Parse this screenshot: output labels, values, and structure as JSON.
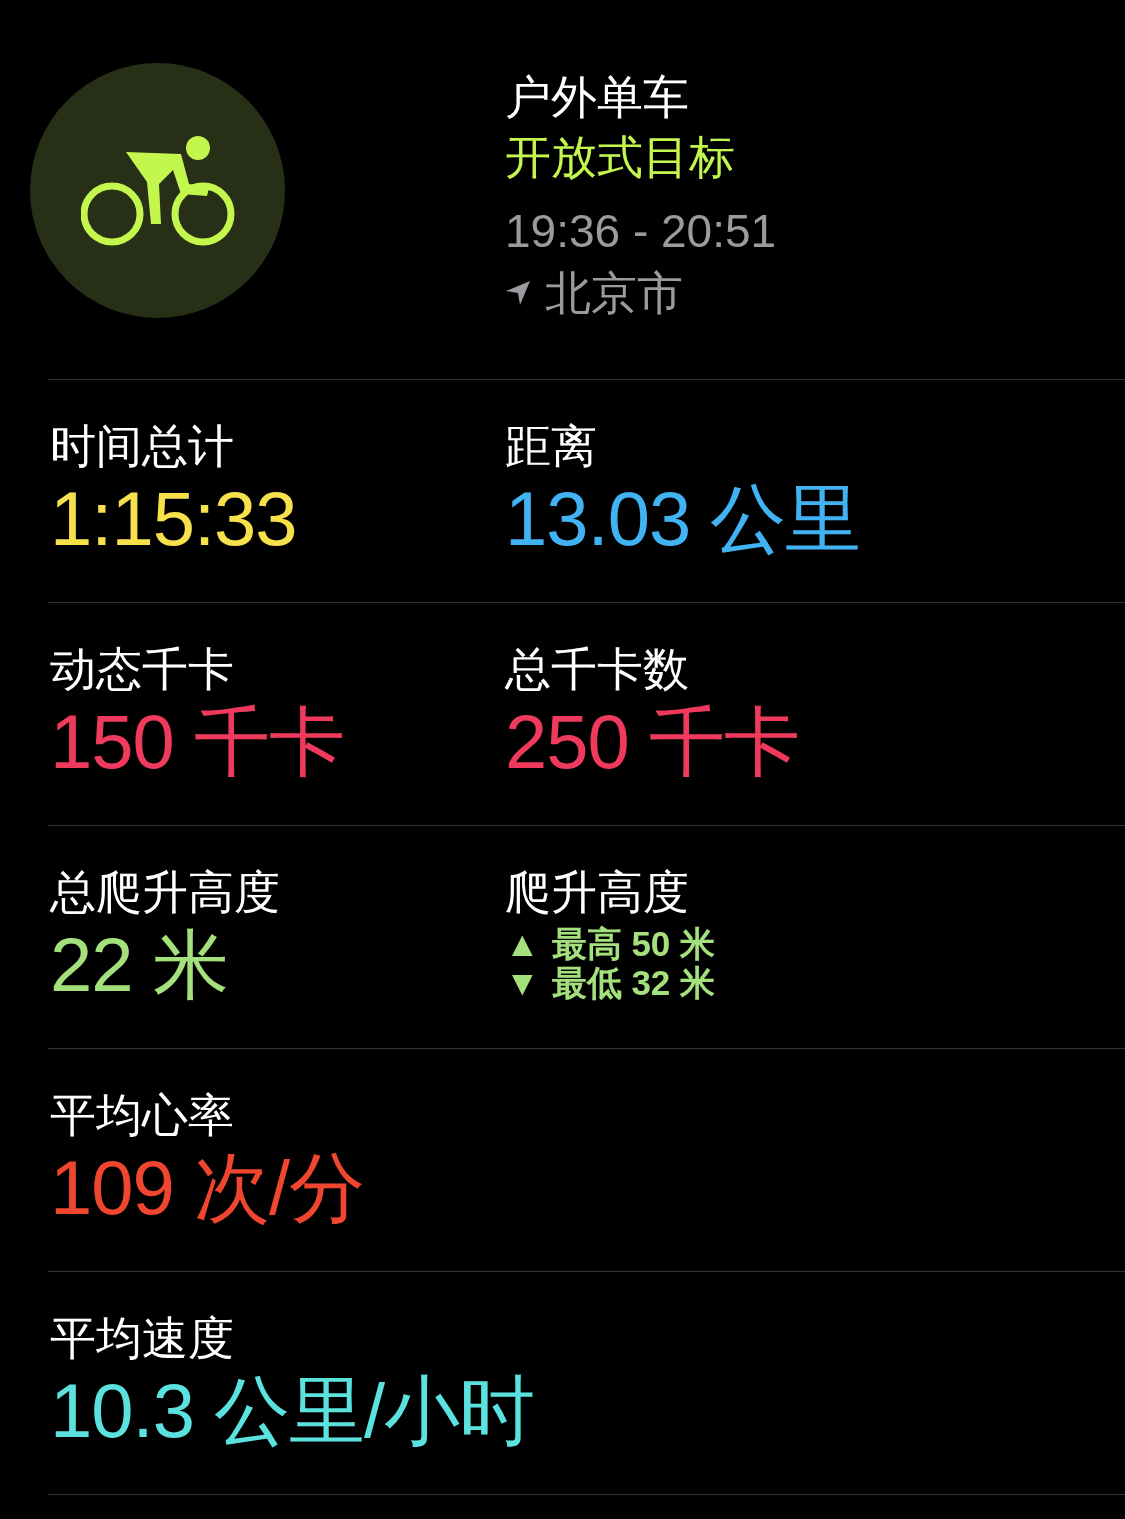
{
  "workout": {
    "title": "户外单车",
    "goal": "开放式目标",
    "time_range": "19:36 - 20:51",
    "location": "北京市"
  },
  "rows": [
    [
      {
        "kind": "value",
        "label": "时间总计",
        "value": "1:15:33",
        "color": "#f6e04b"
      },
      {
        "kind": "value",
        "label": "距离",
        "value": "13.03 公里",
        "color": "#41b3f3"
      }
    ],
    [
      {
        "kind": "value",
        "label": "动态千卡",
        "value": "150 千卡",
        "color": "#ef3a5d"
      },
      {
        "kind": "value",
        "label": "总千卡数",
        "value": "250 千卡",
        "color": "#ef3a5d"
      }
    ],
    [
      {
        "kind": "value",
        "label": "总爬升高度",
        "value": "22 米",
        "color": "#a4e07c"
      },
      {
        "kind": "range",
        "label": "爬升高度",
        "color": "#a4e07c",
        "lines": [
          {
            "arrow": "▲",
            "text": "最高 50 米"
          },
          {
            "arrow": "▼",
            "text": "最低 32 米"
          }
        ]
      }
    ],
    [
      {
        "kind": "value",
        "label": "平均心率",
        "value": "109 次/分",
        "color": "#f0462f"
      }
    ],
    [
      {
        "kind": "value",
        "label": "平均速度",
        "value": "10.3 公里/小时",
        "color": "#5be2de"
      }
    ]
  ]
}
